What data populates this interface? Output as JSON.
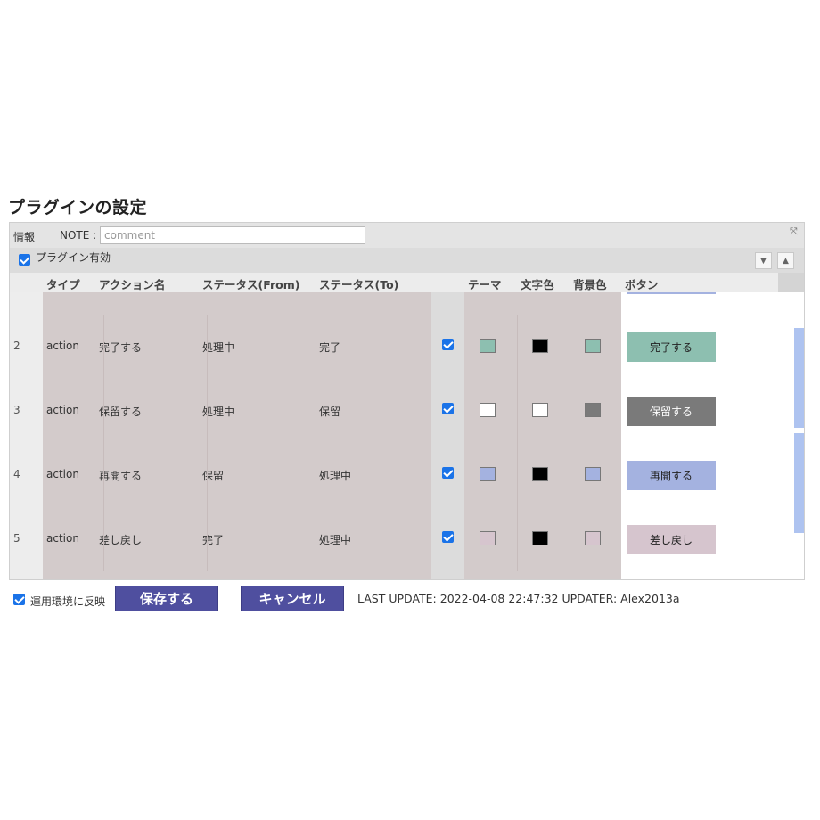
{
  "page_title": "プラグインの設定",
  "info": {
    "label": "情報",
    "note_label": "NOTE :",
    "note_placeholder": "comment",
    "note_value": ""
  },
  "plugin_enabled": {
    "label": "プラグイン有効",
    "checked": true
  },
  "toolbar": {
    "collapse_icon": "arrow-down-bar-icon",
    "expand_icon": "arrow-up-bar-icon",
    "close_icon": "close-icon"
  },
  "table": {
    "headers": [
      "タイプ",
      "アクション名",
      "ステータス(From)",
      "ステータス(To)",
      "",
      "テーマ",
      "文字色",
      "背景色",
      "ボタン"
    ],
    "rows": [
      {
        "num": "2",
        "type": "action",
        "name": "完了する",
        "from": "処理中",
        "to": "完了",
        "checked": true,
        "theme": "#8dbfb0",
        "text_color": "#000000",
        "bg_color": "#8dbfb0",
        "button": "完了する",
        "btn_bg": "#8dbfb0",
        "btn_fg": "#222222"
      },
      {
        "num": "3",
        "type": "action",
        "name": "保留する",
        "from": "処理中",
        "to": "保留",
        "checked": true,
        "theme": "#ffffff",
        "text_color": "#ffffff",
        "bg_color": "#7a7a7a",
        "button": "保留する",
        "btn_bg": "#7a7a7a",
        "btn_fg": "#ffffff"
      },
      {
        "num": "4",
        "type": "action",
        "name": "再開する",
        "from": "保留",
        "to": "処理中",
        "checked": true,
        "theme": "#a4b2e0",
        "text_color": "#000000",
        "bg_color": "#a4b2e0",
        "button": "再開する",
        "btn_bg": "#a4b2e0",
        "btn_fg": "#222222"
      },
      {
        "num": "5",
        "type": "action",
        "name": "差し戻し",
        "from": "完了",
        "to": "処理中",
        "checked": true,
        "theme": "#d6c5ce",
        "text_color": "#000000",
        "bg_color": "#d6c5ce",
        "button": "差し戻し",
        "btn_bg": "#d6c5ce",
        "btn_fg": "#222222"
      }
    ]
  },
  "footer": {
    "apply_label": "運用環境に反映",
    "apply_checked": true,
    "save_label": "保存する",
    "cancel_label": "キャンセル",
    "update_text": "LAST UPDATE: 2022-04-08 22:47:32 UPDATER: Alex2013a"
  }
}
